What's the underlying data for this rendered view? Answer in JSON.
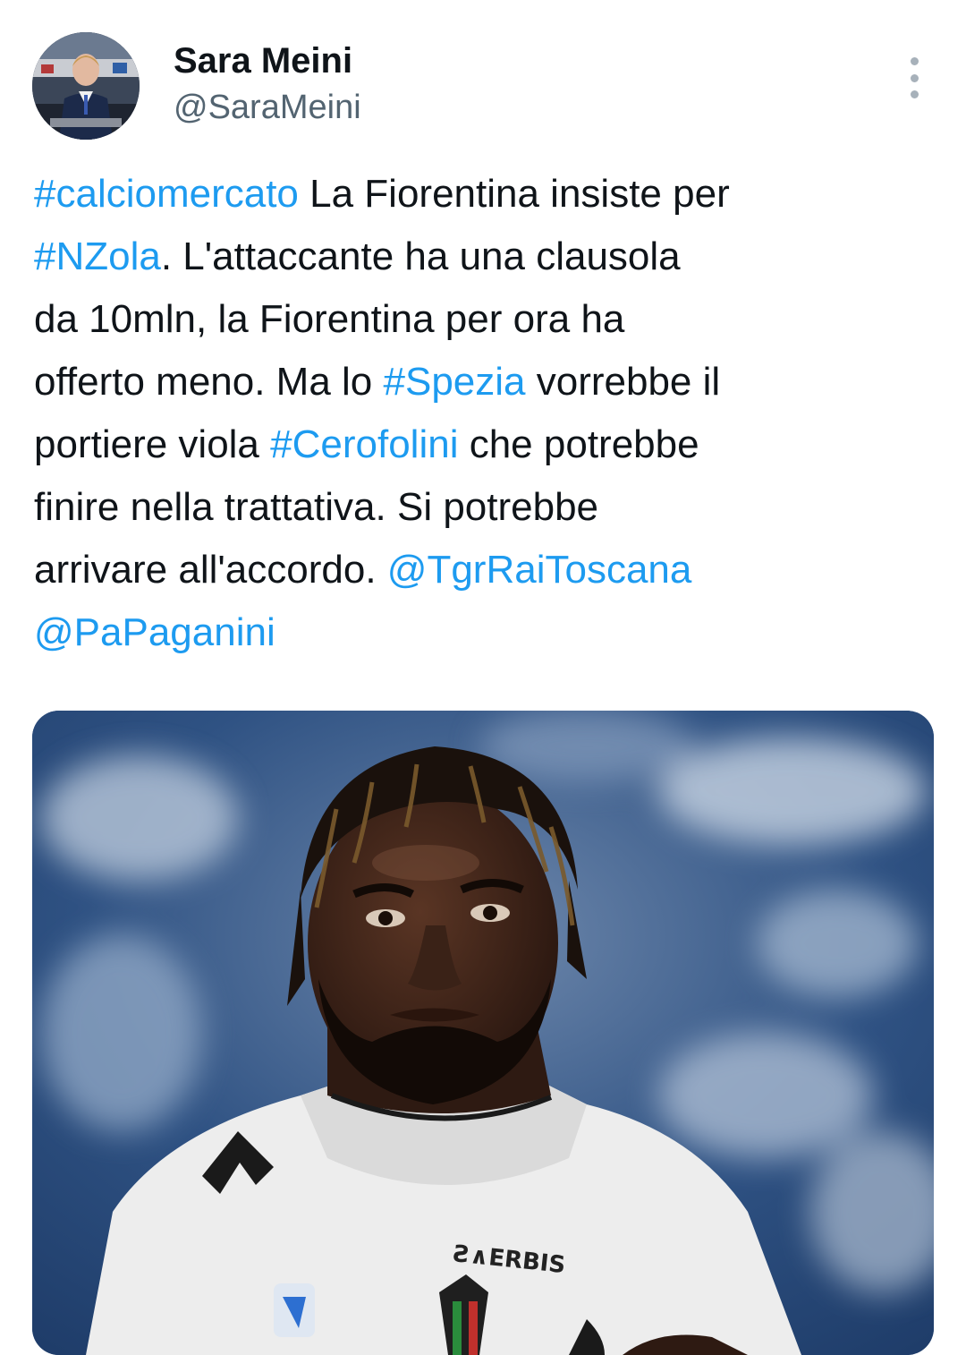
{
  "user": {
    "display_name": "Sara Meini",
    "handle": "@SaraMeini"
  },
  "menu": {
    "icon": "more-vertical-icon"
  },
  "tweet": {
    "lines": [
      [
        {
          "text": "#calciomercato",
          "link": true
        },
        {
          "text": " La Fiorentina insiste per",
          "link": false
        }
      ],
      [
        {
          "text": "#NZola",
          "link": true
        },
        {
          "text": ". L'attaccante ha una clausola",
          "link": false
        }
      ],
      [
        {
          "text": "da 10mln, la Fiorentina per ora ha",
          "link": false
        }
      ],
      [
        {
          "text": "offerto meno. Ma lo ",
          "link": false
        },
        {
          "text": "#Spezia",
          "link": true
        },
        {
          "text": " vorrebbe il",
          "link": false
        }
      ],
      [
        {
          "text": "portiere viola ",
          "link": false
        },
        {
          "text": "#Cerofolini",
          "link": true
        },
        {
          "text": " che potrebbe",
          "link": false
        }
      ],
      [
        {
          "text": "finire nella trattativa. Si potrebbe",
          "link": false
        }
      ],
      [
        {
          "text": "arrivare all'accordo. ",
          "link": false
        },
        {
          "text": "@TgrRaiToscana",
          "link": true
        }
      ],
      [
        {
          "text": "@PaPaganini",
          "link": true
        }
      ]
    ]
  },
  "colors": {
    "link": "#1d9bf0",
    "text": "#0f1419",
    "secondary": "#536471",
    "jersey": "#f2f2f2",
    "background_blur": "#2c4d7c"
  }
}
